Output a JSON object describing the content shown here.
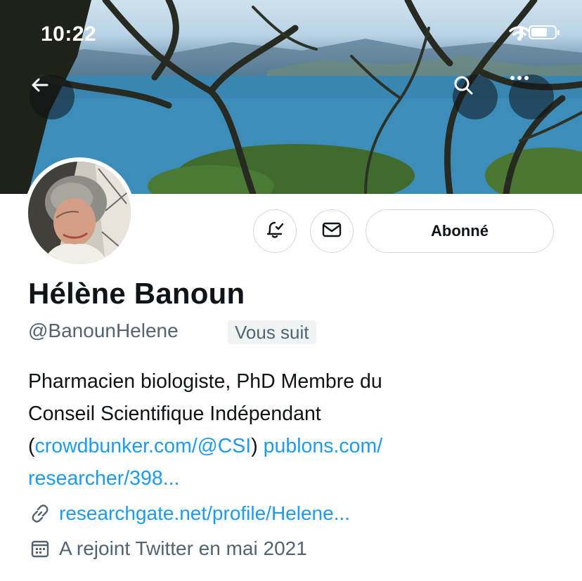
{
  "status_bar": {
    "time": "10:22",
    "icons": [
      "signal-icon",
      "wifi-icon",
      "battery-icon"
    ]
  },
  "header": {
    "back_icon": "arrow-left-icon",
    "search_icon": "search-icon",
    "more_icon": "more-horizontal-icon"
  },
  "actions": {
    "notifications_icon": "bell-check-icon",
    "message_icon": "envelope-icon",
    "follow_label": "Abonné"
  },
  "profile": {
    "name": "Hélène Banoun",
    "handle": "@BanounHelene",
    "follows_you": "Vous suit",
    "bio": {
      "line1": "Pharmacien biologiste, PhD Membre du",
      "line2": "Conseil Scientifique Indépendant",
      "paren_open": "(",
      "link1": "crowdbunker.com/@CSI",
      "paren_close": ")",
      "link2_part1": "publons.com/",
      "link2_part2": "researcher/398..."
    },
    "website": "researchgate.net/profile/Helene...",
    "joined": "A rejoint Twitter en mai 2021"
  },
  "colors": {
    "accent": "#1d9bf0",
    "text": "#0f1419",
    "secondary": "#536471",
    "border": "#cfd9de"
  }
}
